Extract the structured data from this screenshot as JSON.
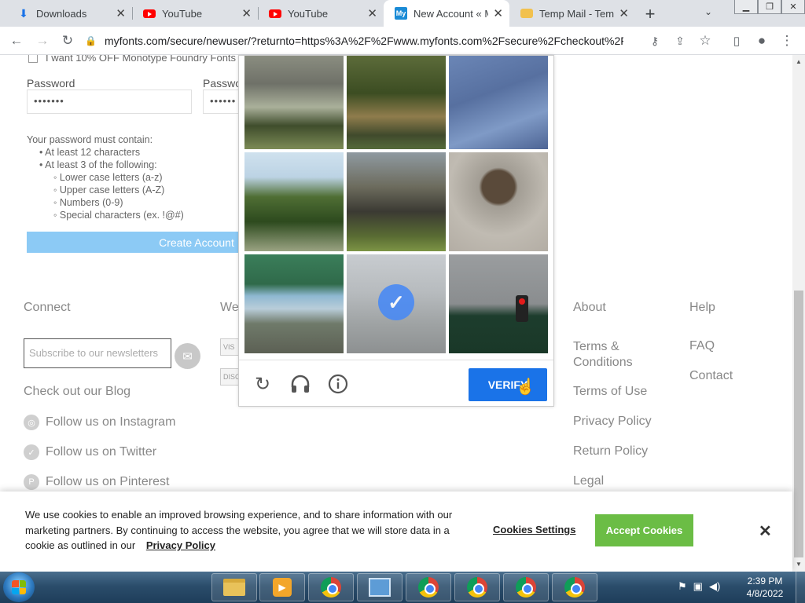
{
  "browser": {
    "tabs": [
      {
        "title": "Downloads",
        "icon": "download-icon"
      },
      {
        "title": "YouTube",
        "icon": "youtube-icon"
      },
      {
        "title": "YouTube",
        "icon": "youtube-icon"
      },
      {
        "title": "New Account « M",
        "icon": "myfonts-icon",
        "active": true
      },
      {
        "title": "Temp Mail - Temp",
        "icon": "tempmail-icon"
      }
    ],
    "url": "myfonts.com/secure/newuser/?returnto=https%3A%2F%2Fwww.myfonts.com%2Fsecure%2Fcheckout%2F"
  },
  "form": {
    "optin_label": "I want 10% OFF Monotype Foundry Fonts",
    "password_label": "Password",
    "password_value": "•••••••",
    "confirm_label": "Passwo",
    "confirm_value": "••••••",
    "rules_title": "Your password must contain:",
    "rules": [
      "At least 12 characters",
      "At least 3 of the following:"
    ],
    "subrules": [
      "Lower case letters (a-z)",
      "Upper case letters (A-Z)",
      "Numbers (0-9)",
      "Special characters (ex. !@#)"
    ],
    "create_button": "Create Account"
  },
  "footer": {
    "connect": "Connect",
    "we_label": "We",
    "newsletter_placeholder": "Subscribe to our newsletters",
    "blog": "Check out our Blog",
    "instagram": "Follow us on Instagram",
    "twitter": "Follow us on Twitter",
    "pinterest": "Follow us on Pinterest",
    "about": "About",
    "help": "Help",
    "terms_conditions": "Terms & Conditions",
    "terms_use": "Terms of Use",
    "privacy": "Privacy Policy",
    "return": "Return Policy",
    "legal": "Legal",
    "faq": "FAQ",
    "contact": "Contact",
    "card_visa": "VIS",
    "card_discover": "DISC"
  },
  "captcha": {
    "verify_label": "VERIFY",
    "selected_tiles": [
      7
    ]
  },
  "cookie": {
    "text": "We use cookies to enable an improved browsing experience, and to share information with our marketing partners. By continuing to access the website, you agree that we will store data in a cookie as outlined in our",
    "privacy_link": "Privacy Policy",
    "settings": "Cookies Settings",
    "accept": "Accept Cookies"
  },
  "taskbar": {
    "time": "2:39 PM",
    "date": "4/8/2022"
  },
  "colors": {
    "accent": "#1a73e8",
    "accept_green": "#6bbd45",
    "create_button": "#8ccaf5"
  }
}
